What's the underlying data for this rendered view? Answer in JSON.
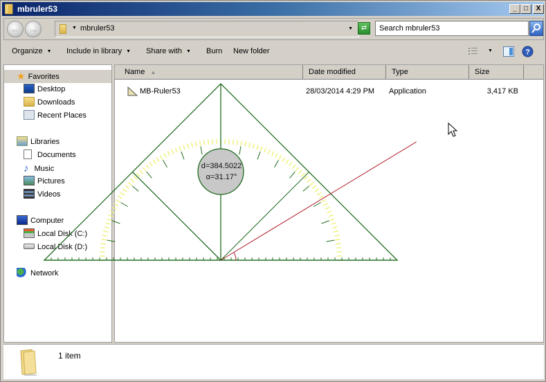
{
  "window": {
    "title": "mbruler53",
    "controls": {
      "minimize": "_",
      "maximize": "□",
      "close": "X"
    }
  },
  "navigation": {
    "back_icon": "back-arrow-icon",
    "forward_icon": "forward-arrow-icon",
    "address_path": "mbruler53",
    "search_placeholder": "Search mbruler53"
  },
  "toolbar": {
    "organize": "Organize",
    "include_in_library": "Include in library",
    "share_with": "Share with",
    "burn": "Burn",
    "new_folder": "New folder"
  },
  "sidebar": {
    "favorites": {
      "label": "Favorites",
      "items": [
        {
          "label": "Desktop",
          "icon": "desktop-icon"
        },
        {
          "label": "Downloads",
          "icon": "downloads-icon"
        },
        {
          "label": "Recent Places",
          "icon": "recent-places-icon"
        }
      ]
    },
    "libraries": {
      "label": "Libraries",
      "items": [
        {
          "label": "Documents",
          "icon": "documents-icon"
        },
        {
          "label": "Music",
          "icon": "music-icon"
        },
        {
          "label": "Pictures",
          "icon": "pictures-icon"
        },
        {
          "label": "Videos",
          "icon": "videos-icon"
        }
      ]
    },
    "computer": {
      "label": "Computer",
      "items": [
        {
          "label": "Local Disk (C:)",
          "icon": "local-disk-c-icon"
        },
        {
          "label": "Local Disk (D:)",
          "icon": "local-disk-d-icon"
        }
      ]
    },
    "network": {
      "label": "Network"
    }
  },
  "file_list": {
    "columns": [
      "Name",
      "Date modified",
      "Type",
      "Size"
    ],
    "sort_indicator": "^",
    "rows": [
      {
        "name": "MB-Ruler53",
        "date_modified": "28/03/2014 4:29 PM",
        "type": "Application",
        "size": "3,417 KB"
      }
    ]
  },
  "status_bar": {
    "item_count": "1 item"
  },
  "ruler_overlay": {
    "distance_label": "d=384.5022",
    "angle_label": "α=31.17°",
    "distance": 384.5022,
    "angle_deg": 31.17,
    "colors": {
      "ruler_line": "#1f6b1f",
      "scale_tick": "#f0f080",
      "measure_line": "#b01c2c",
      "readout_fill": "#c8c8c8"
    }
  }
}
